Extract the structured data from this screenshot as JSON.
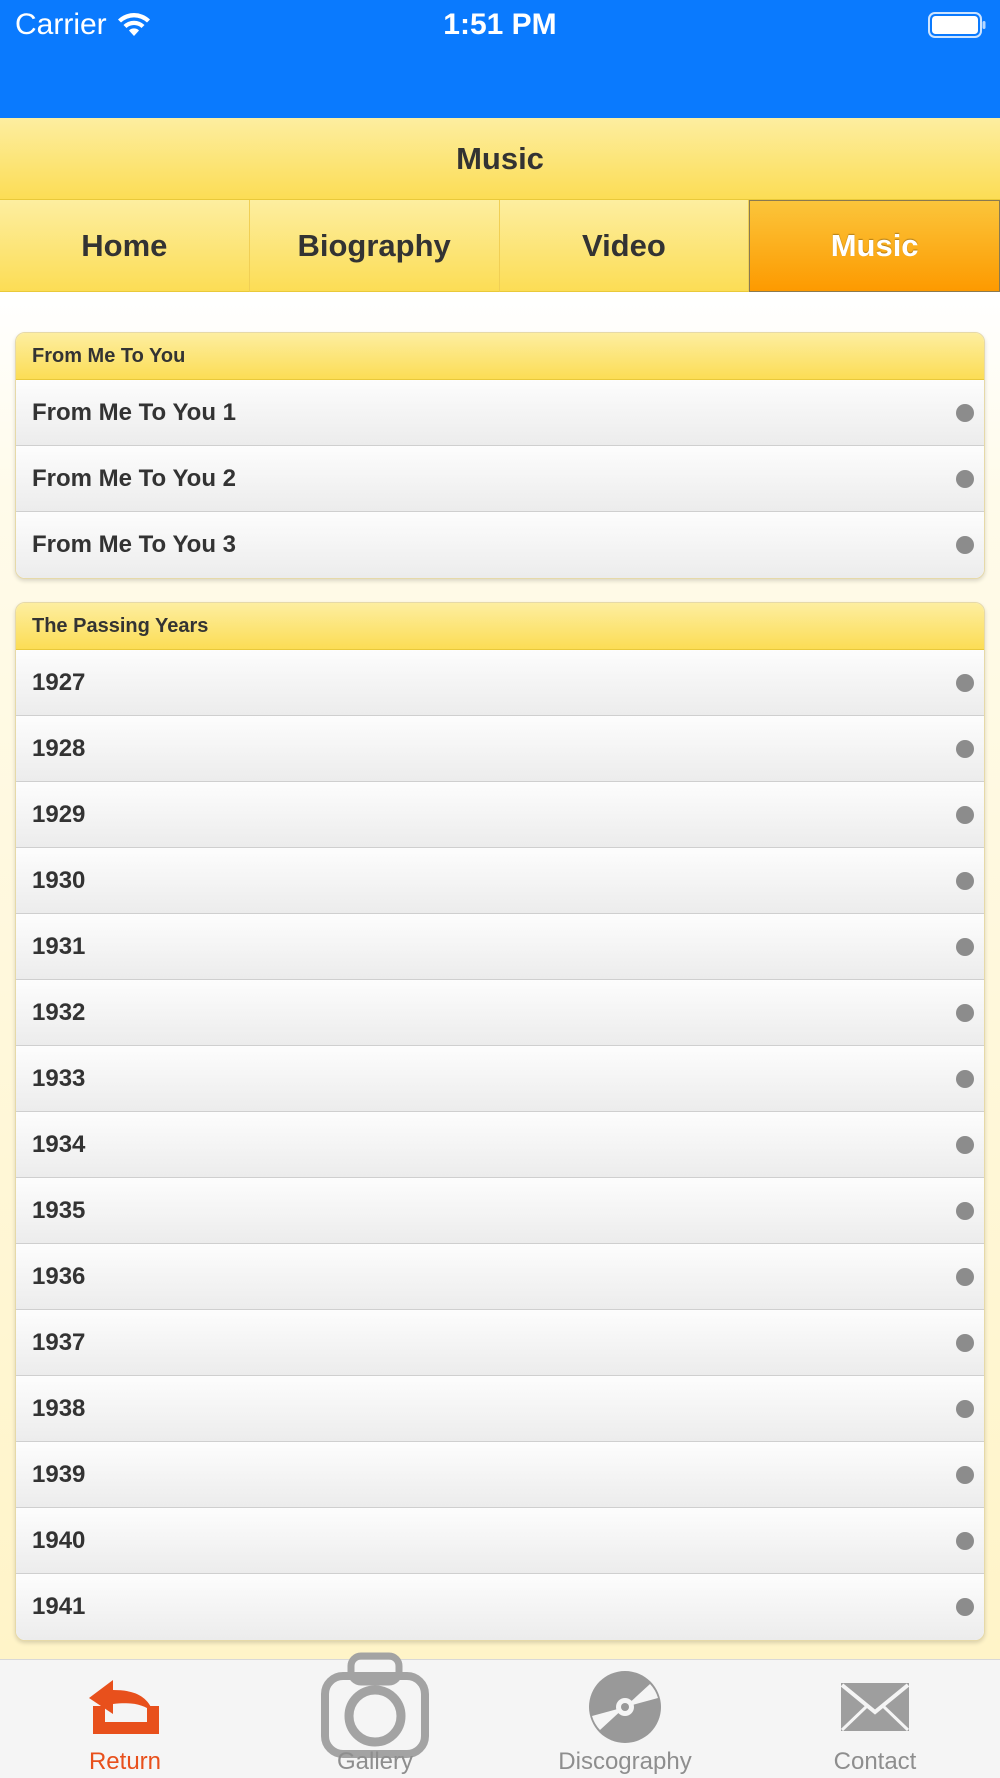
{
  "status_bar": {
    "carrier": "Carrier",
    "time": "1:51 PM"
  },
  "header": {
    "title": "Music"
  },
  "nav_tabs": [
    {
      "label": "Home",
      "active": false
    },
    {
      "label": "Biography",
      "active": false
    },
    {
      "label": "Video",
      "active": false
    },
    {
      "label": "Music",
      "active": true
    }
  ],
  "groups": [
    {
      "title": "From Me To You",
      "items": [
        "From Me To You 1",
        "From Me To You 2",
        "From Me To You 3"
      ]
    },
    {
      "title": "The Passing Years",
      "items": [
        "1927",
        "1928",
        "1929",
        "1930",
        "1931",
        "1932",
        "1933",
        "1934",
        "1935",
        "1936",
        "1937",
        "1938",
        "1939",
        "1940",
        "1941"
      ]
    }
  ],
  "tab_bar": [
    {
      "label": "Return",
      "icon": "return-icon",
      "active": true
    },
    {
      "label": "Gallery",
      "icon": "camera-icon",
      "active": false
    },
    {
      "label": "Discography",
      "icon": "disc-icon",
      "active": false
    },
    {
      "label": "Contact",
      "icon": "envelope-icon",
      "active": false
    }
  ],
  "colors": {
    "status_bar": "#0a7afe",
    "header_yellow": "#fcdd55",
    "active_tab_orange": "#fd9a00",
    "active_tabbar": "#e8501c",
    "inactive_tabbar": "#8e8e8e"
  }
}
